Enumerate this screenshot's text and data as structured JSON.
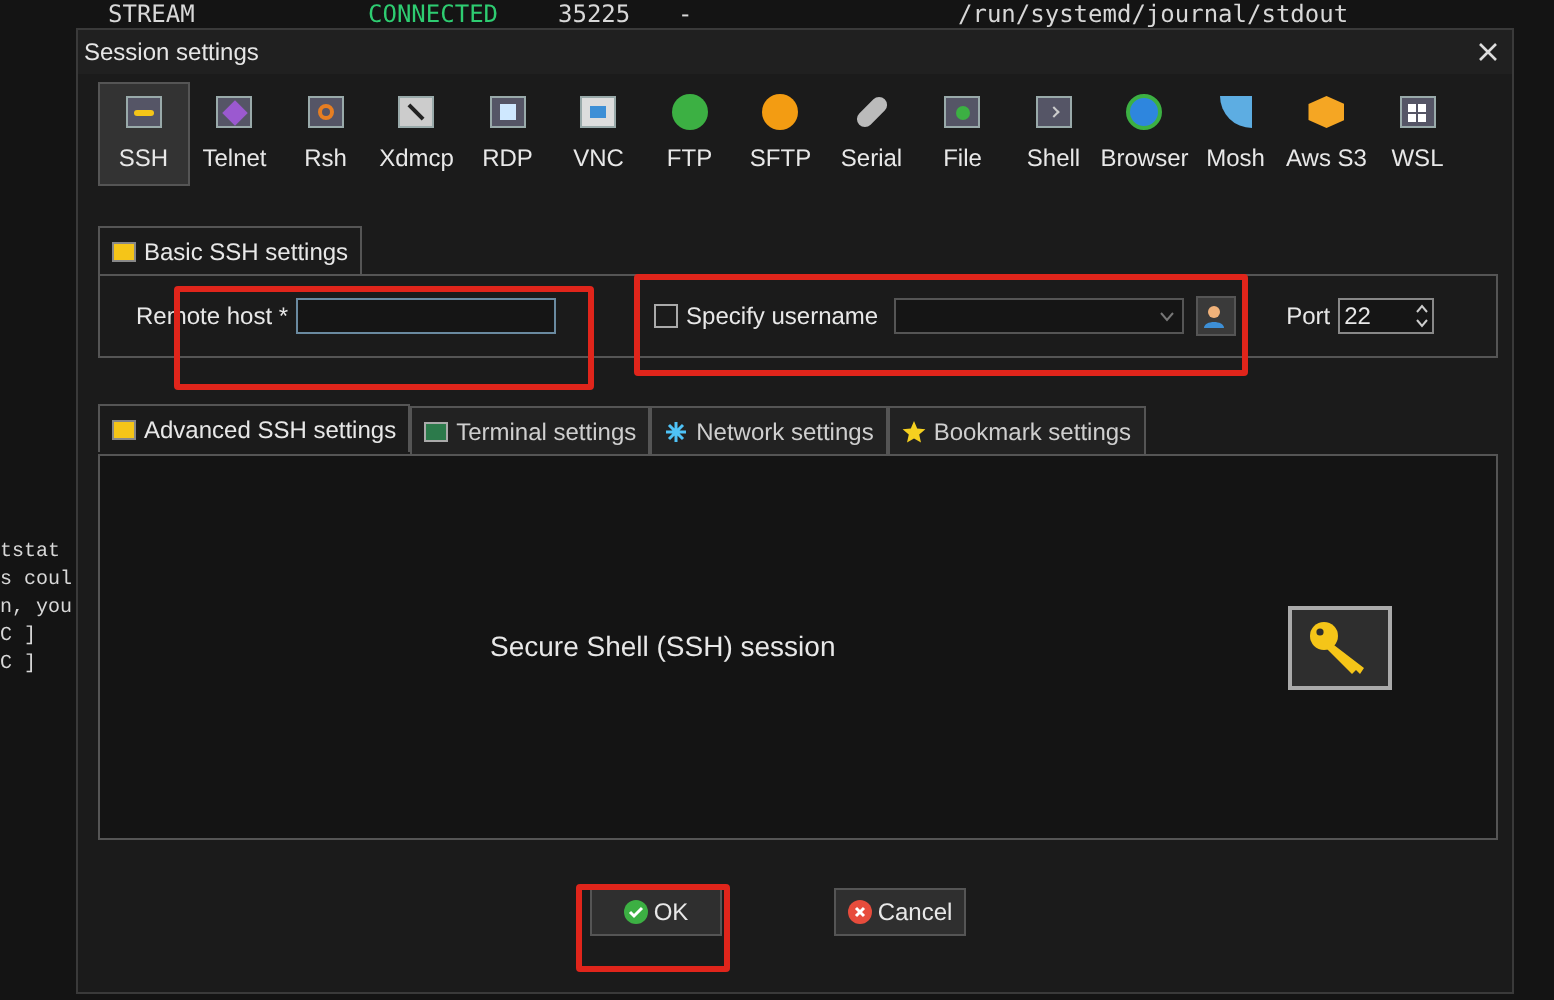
{
  "terminal": {
    "top_row": [
      "STREAM",
      "CONNECTED",
      "35225",
      "-",
      "/run/systemd/journal/stdout"
    ],
    "left_lines": [
      "tstat",
      "s coul",
      "n, you",
      "C ]",
      "C ]"
    ]
  },
  "dialog": {
    "title": "Session settings",
    "protocols": [
      {
        "label": "SSH",
        "selected": true
      },
      {
        "label": "Telnet",
        "selected": false
      },
      {
        "label": "Rsh",
        "selected": false
      },
      {
        "label": "Xdmcp",
        "selected": false
      },
      {
        "label": "RDP",
        "selected": false
      },
      {
        "label": "VNC",
        "selected": false
      },
      {
        "label": "FTP",
        "selected": false
      },
      {
        "label": "SFTP",
        "selected": false
      },
      {
        "label": "Serial",
        "selected": false
      },
      {
        "label": "File",
        "selected": false
      },
      {
        "label": "Shell",
        "selected": false
      },
      {
        "label": "Browser",
        "selected": false
      },
      {
        "label": "Mosh",
        "selected": false
      },
      {
        "label": "Aws S3",
        "selected": false
      },
      {
        "label": "WSL",
        "selected": false
      }
    ],
    "basic_tab": "Basic SSH settings",
    "remote_host": {
      "label": "Remote host *"
    },
    "specify_username": {
      "label": "Specify username",
      "checked": false
    },
    "port": {
      "label": "Port",
      "value": "22"
    },
    "tabs": [
      {
        "label": "Advanced SSH settings",
        "selected": true
      },
      {
        "label": "Terminal settings",
        "selected": false
      },
      {
        "label": "Network settings",
        "selected": false
      },
      {
        "label": "Bookmark settings",
        "selected": false
      }
    ],
    "panel_text": "Secure Shell (SSH) session",
    "buttons": [
      {
        "label": "OK",
        "kind": "ok"
      },
      {
        "label": "Cancel",
        "kind": "cancel"
      }
    ]
  }
}
